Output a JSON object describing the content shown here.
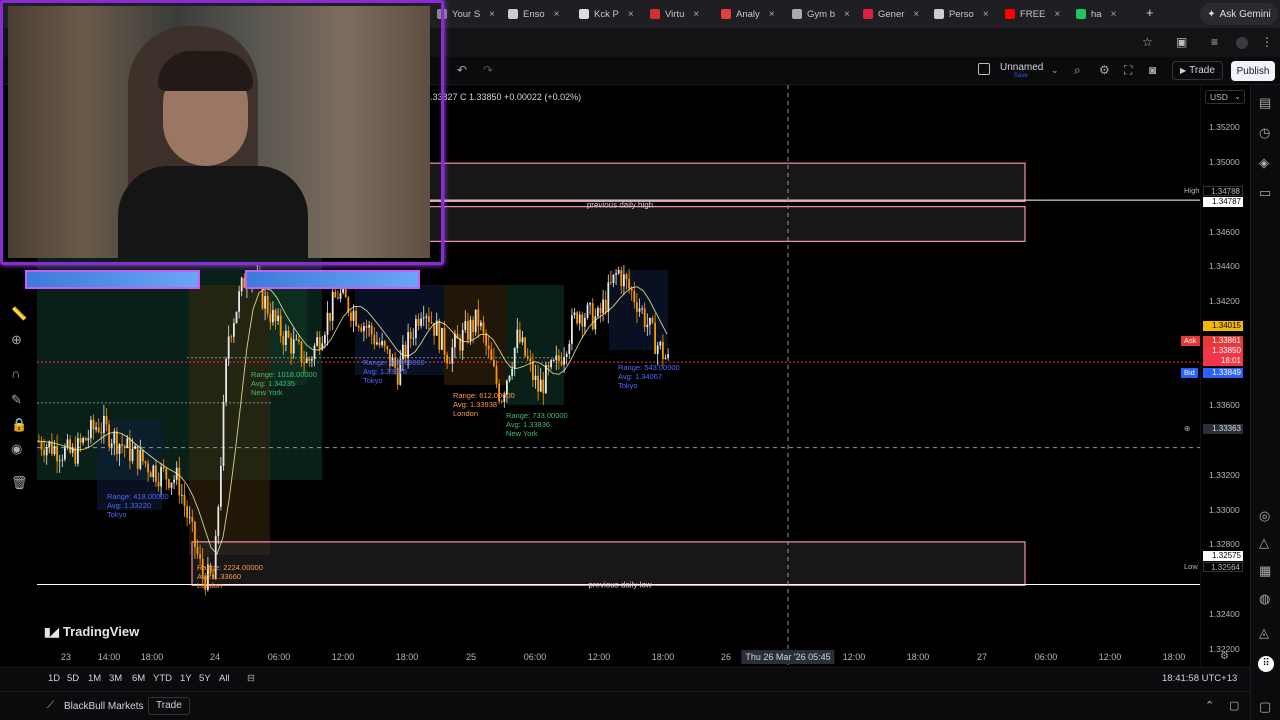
{
  "browser": {
    "tabs": [
      {
        "label": "Your S",
        "color": "#888888"
      },
      {
        "label": "Enso",
        "color": "#cccccc"
      },
      {
        "label": "Kck P",
        "color": "#dddddd"
      },
      {
        "label": "Virtu",
        "color": "#d03030"
      },
      {
        "label": "Analy",
        "color": "#e04040"
      },
      {
        "label": "Gym b",
        "color": "#aaaaaa"
      },
      {
        "label": "Gener",
        "color": "#e02040"
      },
      {
        "label": "Perso",
        "color": "#cccccc"
      },
      {
        "label": "FREE",
        "color": "#ff0000"
      },
      {
        "label": "ha",
        "color": "#22c55e"
      }
    ],
    "gemini_label": "Ask Gemini"
  },
  "header": {
    "layout_name": "Unnamed",
    "layout_sub": "Save",
    "trade_label": "Trade",
    "publish_label": "Publish"
  },
  "legend": {
    "ohlc": ".33827  C 1.33850  +0.00022 (+0.02%)"
  },
  "price_scale": {
    "currency": "USD",
    "labels": [
      "1.35200",
      "1.35000",
      "1.34600",
      "1.34400",
      "1.34200",
      "1.33600",
      "1.33200",
      "1.33000",
      "1.32800",
      "1.32400",
      "1.32200"
    ],
    "tags": {
      "high_name": "High",
      "high_value": "1.34788",
      "prev_high": "1.34787",
      "alert_value": "1.34015",
      "ask_name": "Ask",
      "ask_value": "1.33861",
      "last_value": "1.33850",
      "countdown": "18:01",
      "bid_name": "Bid",
      "bid_value": "1.33849",
      "crosshair_value": "1.33363",
      "prev_low": "1.32575",
      "low_name": "Low",
      "low_value": "1.32564"
    }
  },
  "chart_data": {
    "type": "candlestick",
    "symbol_quote": "USD",
    "ylim": [
      1.321,
      1.3545
    ],
    "zones": [
      {
        "label": "",
        "top": 1.35,
        "bottom": 1.3478
      },
      {
        "label": "previous daily high",
        "top": 1.3475,
        "bottom": 1.3455
      },
      {
        "label": "previous daily low",
        "top": 1.3282,
        "bottom": 1.3257
      }
    ],
    "sessions": [
      {
        "name": "Tokyo",
        "range": "Range: 418.00000",
        "avg": "Avg: 1.33220"
      },
      {
        "name": "London",
        "range": "Range: 2224.00000",
        "avg": "Avg: 1.33660"
      },
      {
        "name": "New York",
        "range": "Range: 1018.00000",
        "avg": "Avg: 1.34235"
      },
      {
        "name": "Tokyo",
        "range": "Range: 609.00000",
        "avg": "Avg: 1.33976"
      },
      {
        "name": "London",
        "range": "Range: 612.00000",
        "avg": "Avg: 1.33938"
      },
      {
        "name": "New York",
        "range": "Range: 733.00000",
        "avg": "Avg: 1.33836"
      },
      {
        "name": "Tokyo",
        "range": "Range: 543.00000",
        "avg": "Avg: 1.34067"
      }
    ],
    "x_ticks": [
      "23",
      "14:00",
      "18:00",
      "24",
      "06:00",
      "12:00",
      "18:00",
      "25",
      "06:00",
      "12:00",
      "18:00",
      "26",
      "12:00",
      "18:00",
      "27",
      "06:00",
      "12:00",
      "18:00"
    ],
    "crosshair_time": "Thu 26 Mar '26   05:45",
    "watermark": "TradingView"
  },
  "range_bar": {
    "buttons": [
      "1D",
      "5D",
      "1M",
      "3M",
      "6M",
      "YTD",
      "1Y",
      "5Y",
      "All"
    ],
    "clock": "18:41:58 UTC+13"
  },
  "footer": {
    "broker": "BlackBull Markets",
    "trade_label": "Trade"
  }
}
